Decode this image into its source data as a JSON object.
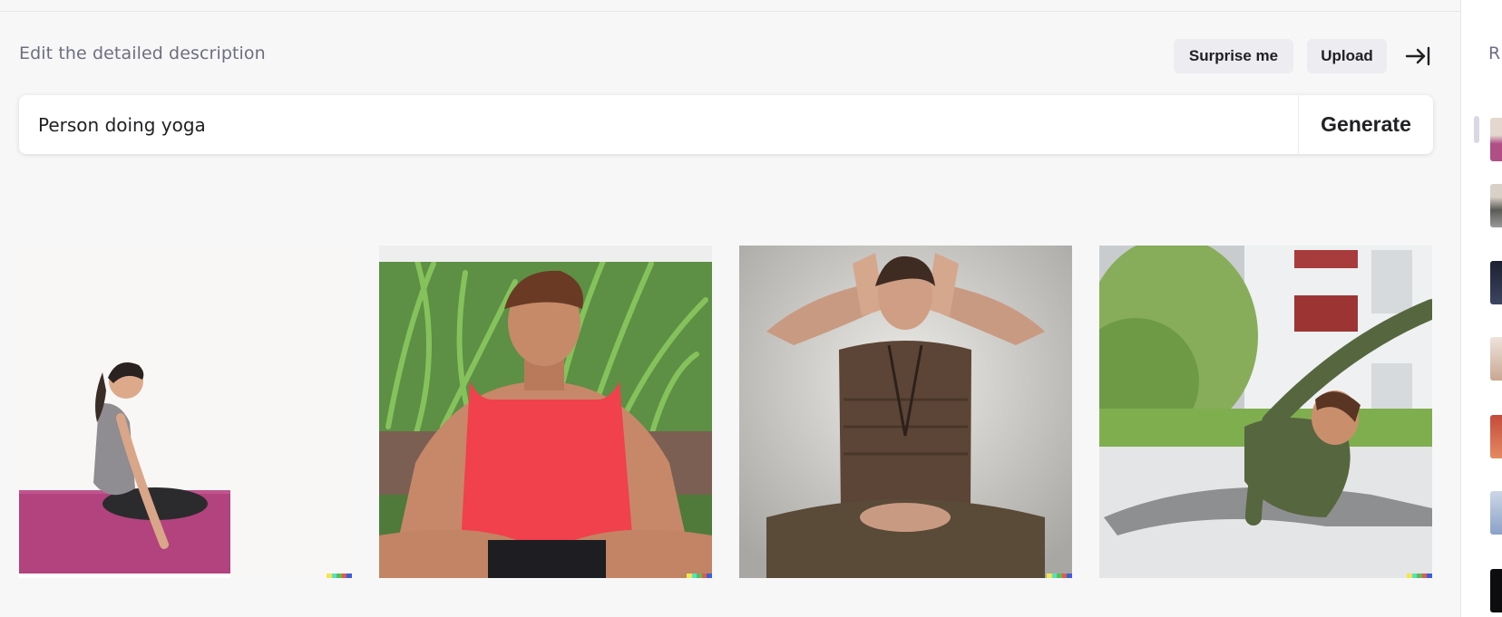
{
  "prompt_section": {
    "label": "Edit the detailed description",
    "surprise_label": "Surprise me",
    "upload_label": "Upload",
    "collapse_icon": "arrow-right-to-bar-icon",
    "prompt_value": "Person doing yoga",
    "generate_label": "Generate"
  },
  "results": [
    {
      "subject": "woman kneeling on a magenta yoga mat against a white background"
    },
    {
      "subject": "young man in red tank top meditating cross-legged in front of green plants"
    },
    {
      "subject": "woman in brown top sitting cross-legged with hands raised to head"
    },
    {
      "subject": "man in green shirt doing a side stretch outdoors near a white building"
    }
  ],
  "history_panel": {
    "title": "R",
    "thumbnail_count": 7
  },
  "colors": {
    "background": "#f7f7f8",
    "pill_bg": "#ececf1",
    "text": "#202123",
    "muted": "#6e6e80"
  }
}
